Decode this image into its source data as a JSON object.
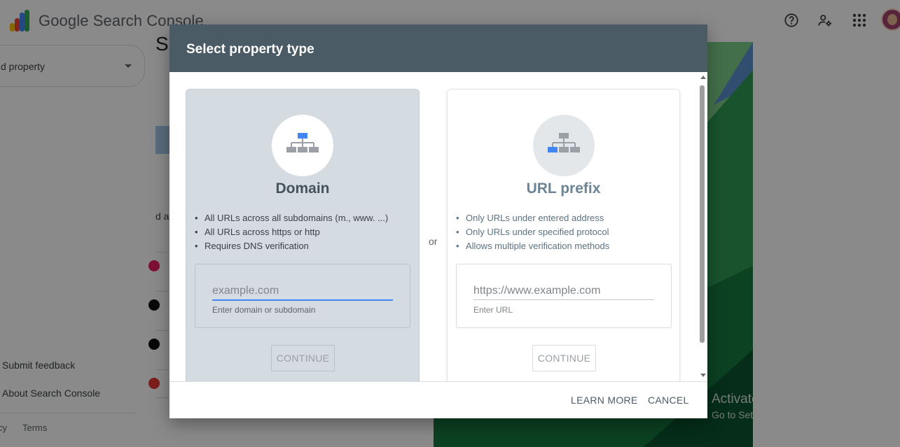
{
  "app": {
    "title_google": "Google",
    "title_product": "Search Console"
  },
  "header_icons": [
    "help-icon",
    "manage-users-icon",
    "apps-grid-icon",
    "account-avatar"
  ],
  "sidebar": {
    "property_select": "d property",
    "links": [
      "Submit feedback",
      "About Search Console"
    ],
    "footer_links": [
      "cy",
      "Terms"
    ]
  },
  "background": {
    "heading_fragment": "S",
    "text_fragment": "d a"
  },
  "dialog": {
    "title": "Select property type",
    "separator": "or",
    "domain": {
      "title": "Domain",
      "bullets": [
        "All URLs across all subdomains (m., www. ...)",
        "All URLs across https or http",
        "Requires DNS verification"
      ],
      "placeholder": "example.com",
      "helper": "Enter domain or subdomain",
      "continue": "CONTINUE"
    },
    "url_prefix": {
      "title": "URL prefix",
      "bullets": [
        "Only URLs under entered address",
        "Only URLs under specified protocol",
        "Allows multiple verification methods"
      ],
      "placeholder": "https://www.example.com",
      "helper": "Enter URL",
      "continue": "CONTINUE"
    },
    "footer": {
      "learn_more": "LEARN MORE",
      "cancel": "CANCEL"
    }
  },
  "windows_watermark": {
    "line1": "Activate Windows",
    "line2": "Go to Settings to activate Windows."
  },
  "colors": {
    "dialog_header": "#4a5b66",
    "accent_blue": "#4285f4",
    "domain_card": "#d4dbe1"
  }
}
